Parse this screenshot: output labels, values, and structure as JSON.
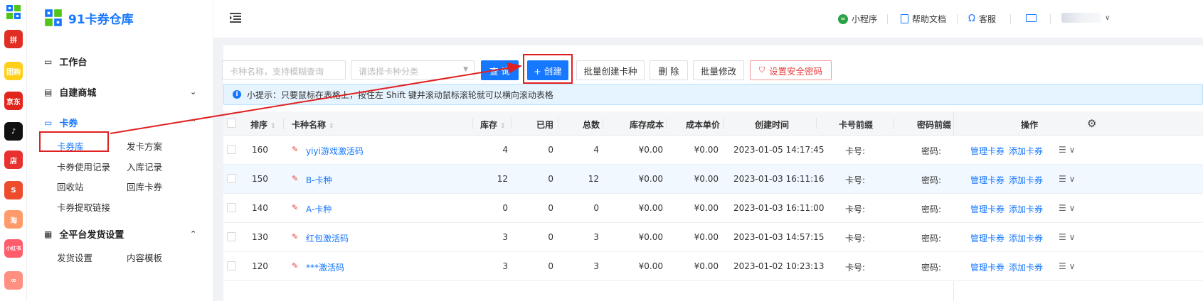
{
  "app": {
    "brand": "91卡券仓库"
  },
  "rail": [
    {
      "icon": "pinduoduo-icon",
      "color": "#e02e24",
      "text": "拼"
    },
    {
      "icon": "taobao-ju-icon",
      "color": "#ffcf1a",
      "text": "团购"
    },
    {
      "icon": "jd-icon",
      "color": "#e1251b",
      "text": "京东"
    },
    {
      "icon": "douyin-icon",
      "color": "#111111",
      "text": "♪"
    },
    {
      "icon": "shop-icon",
      "color": "#e8312f",
      "text": "店"
    },
    {
      "icon": "shopee-icon",
      "color": "#ee4d2d",
      "text": "S"
    },
    {
      "icon": "taobao-icon",
      "color": "#ff9a6b",
      "text": "淘"
    },
    {
      "icon": "xiaohongshu-icon",
      "color": "#ff5c6c",
      "text": "小红书"
    },
    {
      "icon": "misc-app-icon",
      "color": "#ff8f80",
      "text": "∞"
    }
  ],
  "sidebar": {
    "workbench": "工作台",
    "self_mall": "自建商城",
    "card": "卡券",
    "card_items": [
      "卡券库",
      "发卡方案",
      "卡券使用记录",
      "入库记录",
      "回收站",
      "回库卡券",
      "卡券提取链接"
    ],
    "delivery": "全平台发货设置",
    "delivery_items": [
      "发货设置",
      "内容模板"
    ]
  },
  "header": {
    "mini_program": "小程序",
    "help_docs": "帮助文档",
    "service": "客服"
  },
  "toolbar": {
    "name_placeholder": "卡种名称，支持模糊查询",
    "category_placeholder": "请选择卡种分类",
    "query": "查 询",
    "create": "+ 创建",
    "batch_create": "批量创建卡种",
    "delete": "删 除",
    "batch_edit": "批量修改",
    "set_password": "设置安全密码"
  },
  "tip": "小提示：只要鼠标在表格上，按住左 Shift 键并滚动鼠标滚轮就可以横向滚动表格",
  "table": {
    "headers": {
      "order": "排序",
      "name": "卡种名称",
      "stock": "库存",
      "used": "已用",
      "total": "总数",
      "stock_cost": "库存成本",
      "unit_cost": "成本单价",
      "created": "创建时间",
      "card_prefix": "卡号前缀",
      "pwd_prefix": "密码前缀",
      "ops": "操作"
    },
    "rows": [
      {
        "order": "160",
        "name": "yiyi游戏激活码",
        "stock": "4",
        "used": "0",
        "total": "4",
        "stock_cost": "¥0.00",
        "unit_cost": "¥0.00",
        "created": "2023-01-05 14:17:45",
        "card_prefix": "卡号:",
        "pwd_prefix": "密码:",
        "manage": "管理卡券",
        "add": "添加卡券"
      },
      {
        "order": "150",
        "name": "B-卡种",
        "stock": "12",
        "used": "0",
        "total": "12",
        "stock_cost": "¥0.00",
        "unit_cost": "¥0.00",
        "created": "2023-01-03 16:11:16",
        "card_prefix": "卡号:",
        "pwd_prefix": "密码:",
        "manage": "管理卡券",
        "add": "添加卡券"
      },
      {
        "order": "140",
        "name": "A-卡种",
        "stock": "0",
        "used": "0",
        "total": "0",
        "stock_cost": "¥0.00",
        "unit_cost": "¥0.00",
        "created": "2023-01-03 16:11:00",
        "card_prefix": "卡号:",
        "pwd_prefix": "密码:",
        "manage": "管理卡券",
        "add": "添加卡券"
      },
      {
        "order": "130",
        "name": "红包激活码",
        "stock": "3",
        "used": "0",
        "total": "3",
        "stock_cost": "¥0.00",
        "unit_cost": "¥0.00",
        "created": "2023-01-03 14:57:15",
        "card_prefix": "卡号:",
        "pwd_prefix": "密码:",
        "manage": "管理卡券",
        "add": "添加卡券"
      },
      {
        "order": "120",
        "name": "***激活码",
        "stock": "3",
        "used": "0",
        "total": "3",
        "stock_cost": "¥0.00",
        "unit_cost": "¥0.00",
        "created": "2023-01-02 10:23:13",
        "card_prefix": "卡号:",
        "pwd_prefix": "密码:",
        "manage": "管理卡券",
        "add": "添加卡券"
      }
    ]
  },
  "colors": {
    "primary": "#1677ff",
    "annotation": "#e02020",
    "danger": "#e83b3b"
  }
}
